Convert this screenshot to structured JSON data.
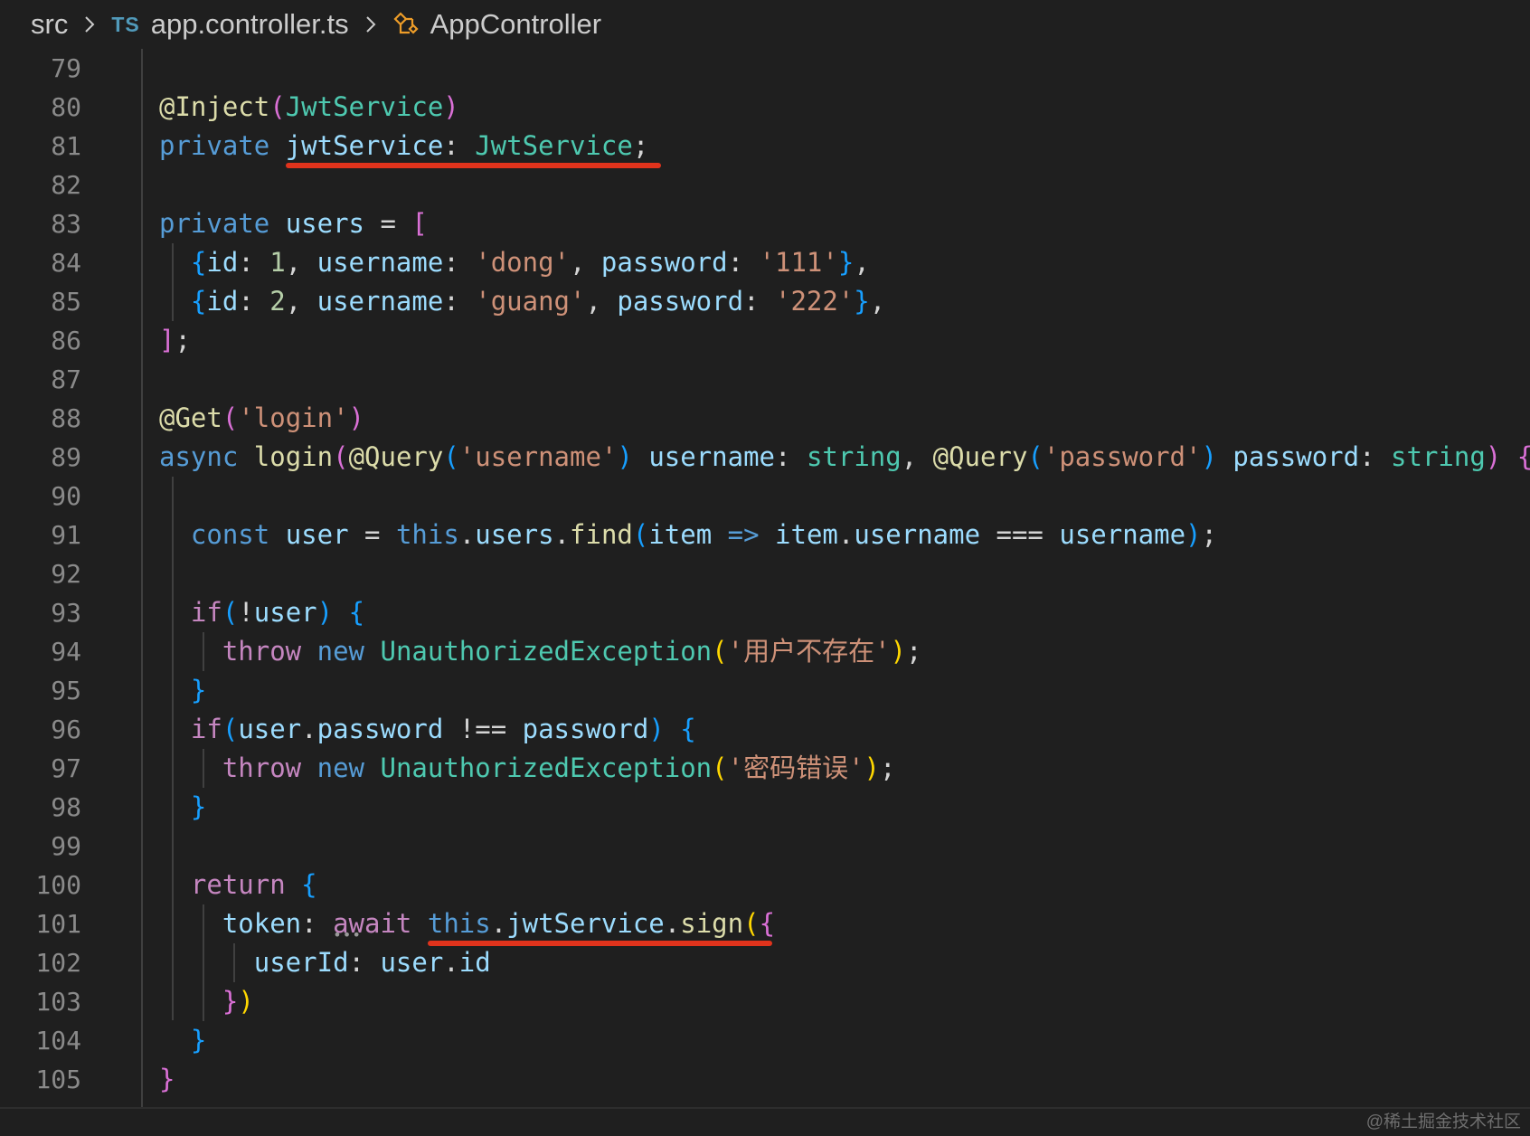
{
  "breadcrumb": {
    "root": "src",
    "file_badge": "TS",
    "file": "app.controller.ts",
    "symbol_icon": "class-symbol-icon",
    "symbol": "AppController"
  },
  "editor": {
    "lines": [
      {
        "n": "79",
        "tokens": []
      },
      {
        "n": "80",
        "tokens": [
          [
            "fn",
            "@Inject"
          ],
          [
            "p2",
            "("
          ],
          [
            "ty",
            "JwtService"
          ],
          [
            "p2",
            ")"
          ]
        ]
      },
      {
        "n": "81",
        "tokens": [
          [
            "kw",
            "private"
          ],
          [
            "pn",
            " "
          ],
          [
            "var",
            "jwtService"
          ],
          [
            "pn",
            ": "
          ],
          [
            "ty",
            "JwtService"
          ],
          [
            "pn",
            ";"
          ]
        ]
      },
      {
        "n": "82",
        "tokens": []
      },
      {
        "n": "83",
        "tokens": [
          [
            "kw",
            "private"
          ],
          [
            "pn",
            " "
          ],
          [
            "var",
            "users"
          ],
          [
            "pn",
            " = "
          ],
          [
            "p2",
            "["
          ]
        ]
      },
      {
        "n": "84",
        "tokens": [
          [
            "pn",
            "  "
          ],
          [
            "p3",
            "{"
          ],
          [
            "var",
            "id"
          ],
          [
            "pn",
            ": "
          ],
          [
            "num",
            "1"
          ],
          [
            "pn",
            ", "
          ],
          [
            "var",
            "username"
          ],
          [
            "pn",
            ": "
          ],
          [
            "str",
            "'dong'"
          ],
          [
            "pn",
            ", "
          ],
          [
            "var",
            "password"
          ],
          [
            "pn",
            ": "
          ],
          [
            "str",
            "'111'"
          ],
          [
            "p3",
            "}"
          ],
          [
            "pn",
            ","
          ]
        ]
      },
      {
        "n": "85",
        "tokens": [
          [
            "pn",
            "  "
          ],
          [
            "p3",
            "{"
          ],
          [
            "var",
            "id"
          ],
          [
            "pn",
            ": "
          ],
          [
            "num",
            "2"
          ],
          [
            "pn",
            ", "
          ],
          [
            "var",
            "username"
          ],
          [
            "pn",
            ": "
          ],
          [
            "str",
            "'guang'"
          ],
          [
            "pn",
            ", "
          ],
          [
            "var",
            "password"
          ],
          [
            "pn",
            ": "
          ],
          [
            "str",
            "'222'"
          ],
          [
            "p3",
            "}"
          ],
          [
            "pn",
            ","
          ]
        ]
      },
      {
        "n": "86",
        "tokens": [
          [
            "p2",
            "]"
          ],
          [
            "pn",
            ";"
          ]
        ]
      },
      {
        "n": "87",
        "tokens": []
      },
      {
        "n": "88",
        "tokens": [
          [
            "fn",
            "@Get"
          ],
          [
            "p2",
            "("
          ],
          [
            "str",
            "'login'"
          ],
          [
            "p2",
            ")"
          ]
        ]
      },
      {
        "n": "89",
        "tokens": [
          [
            "kw",
            "async"
          ],
          [
            "pn",
            " "
          ],
          [
            "fn",
            "login"
          ],
          [
            "p2",
            "("
          ],
          [
            "fn",
            "@Query"
          ],
          [
            "p3",
            "("
          ],
          [
            "str",
            "'username'"
          ],
          [
            "p3",
            ")"
          ],
          [
            "pn",
            " "
          ],
          [
            "var",
            "username"
          ],
          [
            "pn",
            ": "
          ],
          [
            "ty",
            "string"
          ],
          [
            "pn",
            ", "
          ],
          [
            "fn",
            "@Query"
          ],
          [
            "p3",
            "("
          ],
          [
            "str",
            "'password'"
          ],
          [
            "p3",
            ")"
          ],
          [
            "pn",
            " "
          ],
          [
            "var",
            "password"
          ],
          [
            "pn",
            ": "
          ],
          [
            "ty",
            "string"
          ],
          [
            "p2",
            ")"
          ],
          [
            "pn",
            " "
          ],
          [
            "p2",
            "{"
          ]
        ]
      },
      {
        "n": "90",
        "tokens": []
      },
      {
        "n": "91",
        "tokens": [
          [
            "pn",
            "  "
          ],
          [
            "kw",
            "const"
          ],
          [
            "pn",
            " "
          ],
          [
            "var",
            "user"
          ],
          [
            "pn",
            " = "
          ],
          [
            "kw",
            "this"
          ],
          [
            "pn",
            "."
          ],
          [
            "var",
            "users"
          ],
          [
            "pn",
            "."
          ],
          [
            "fn",
            "find"
          ],
          [
            "p3",
            "("
          ],
          [
            "var",
            "item"
          ],
          [
            "pn",
            " "
          ],
          [
            "kw",
            "=>"
          ],
          [
            "pn",
            " "
          ],
          [
            "var",
            "item"
          ],
          [
            "pn",
            "."
          ],
          [
            "var",
            "username"
          ],
          [
            "pn",
            " === "
          ],
          [
            "var",
            "username"
          ],
          [
            "p3",
            ")"
          ],
          [
            "pn",
            ";"
          ]
        ]
      },
      {
        "n": "92",
        "tokens": []
      },
      {
        "n": "93",
        "tokens": [
          [
            "pn",
            "  "
          ],
          [
            "kw2",
            "if"
          ],
          [
            "p3",
            "("
          ],
          [
            "pn",
            "!"
          ],
          [
            "var",
            "user"
          ],
          [
            "p3",
            ")"
          ],
          [
            "pn",
            " "
          ],
          [
            "p3",
            "{"
          ]
        ]
      },
      {
        "n": "94",
        "tokens": [
          [
            "pn",
            "    "
          ],
          [
            "kw2",
            "throw"
          ],
          [
            "pn",
            " "
          ],
          [
            "kw",
            "new"
          ],
          [
            "pn",
            " "
          ],
          [
            "ty",
            "UnauthorizedException"
          ],
          [
            "p1",
            "("
          ],
          [
            "str",
            "'用户不存在'"
          ],
          [
            "p1",
            ")"
          ],
          [
            "pn",
            ";"
          ]
        ]
      },
      {
        "n": "95",
        "tokens": [
          [
            "pn",
            "  "
          ],
          [
            "p3",
            "}"
          ]
        ]
      },
      {
        "n": "96",
        "tokens": [
          [
            "pn",
            "  "
          ],
          [
            "kw2",
            "if"
          ],
          [
            "p3",
            "("
          ],
          [
            "var",
            "user"
          ],
          [
            "pn",
            "."
          ],
          [
            "var",
            "password"
          ],
          [
            "pn",
            " !== "
          ],
          [
            "var",
            "password"
          ],
          [
            "p3",
            ")"
          ],
          [
            "pn",
            " "
          ],
          [
            "p3",
            "{"
          ]
        ]
      },
      {
        "n": "97",
        "tokens": [
          [
            "pn",
            "    "
          ],
          [
            "kw2",
            "throw"
          ],
          [
            "pn",
            " "
          ],
          [
            "kw",
            "new"
          ],
          [
            "pn",
            " "
          ],
          [
            "ty",
            "UnauthorizedException"
          ],
          [
            "p1",
            "("
          ],
          [
            "str",
            "'密码错误'"
          ],
          [
            "p1",
            ")"
          ],
          [
            "pn",
            ";"
          ]
        ]
      },
      {
        "n": "98",
        "tokens": [
          [
            "pn",
            "  "
          ],
          [
            "p3",
            "}"
          ]
        ]
      },
      {
        "n": "99",
        "tokens": []
      },
      {
        "n": "100",
        "tokens": [
          [
            "pn",
            "  "
          ],
          [
            "kw2",
            "return"
          ],
          [
            "pn",
            " "
          ],
          [
            "p3",
            "{"
          ]
        ]
      },
      {
        "n": "101",
        "tokens": [
          [
            "pn",
            "    "
          ],
          [
            "var",
            "token"
          ],
          [
            "pn",
            ": "
          ],
          [
            "kw2",
            "await"
          ],
          [
            "pn",
            " "
          ],
          [
            "kw",
            "this"
          ],
          [
            "pn",
            "."
          ],
          [
            "var",
            "jwtService"
          ],
          [
            "pn",
            "."
          ],
          [
            "fn",
            "sign"
          ],
          [
            "p1",
            "("
          ],
          [
            "p2",
            "{"
          ]
        ]
      },
      {
        "n": "102",
        "tokens": [
          [
            "pn",
            "      "
          ],
          [
            "var",
            "userId"
          ],
          [
            "pn",
            ": "
          ],
          [
            "var",
            "user"
          ],
          [
            "pn",
            "."
          ],
          [
            "var",
            "id"
          ]
        ]
      },
      {
        "n": "103",
        "tokens": [
          [
            "pn",
            "    "
          ],
          [
            "p2",
            "}"
          ],
          [
            "p1",
            ")"
          ]
        ]
      },
      {
        "n": "104",
        "tokens": [
          [
            "pn",
            "  "
          ],
          [
            "p3",
            "}"
          ]
        ]
      },
      {
        "n": "105",
        "tokens": [
          [
            "p2",
            "}"
          ]
        ]
      }
    ]
  },
  "watermark": "@稀土掘金技术社区"
}
